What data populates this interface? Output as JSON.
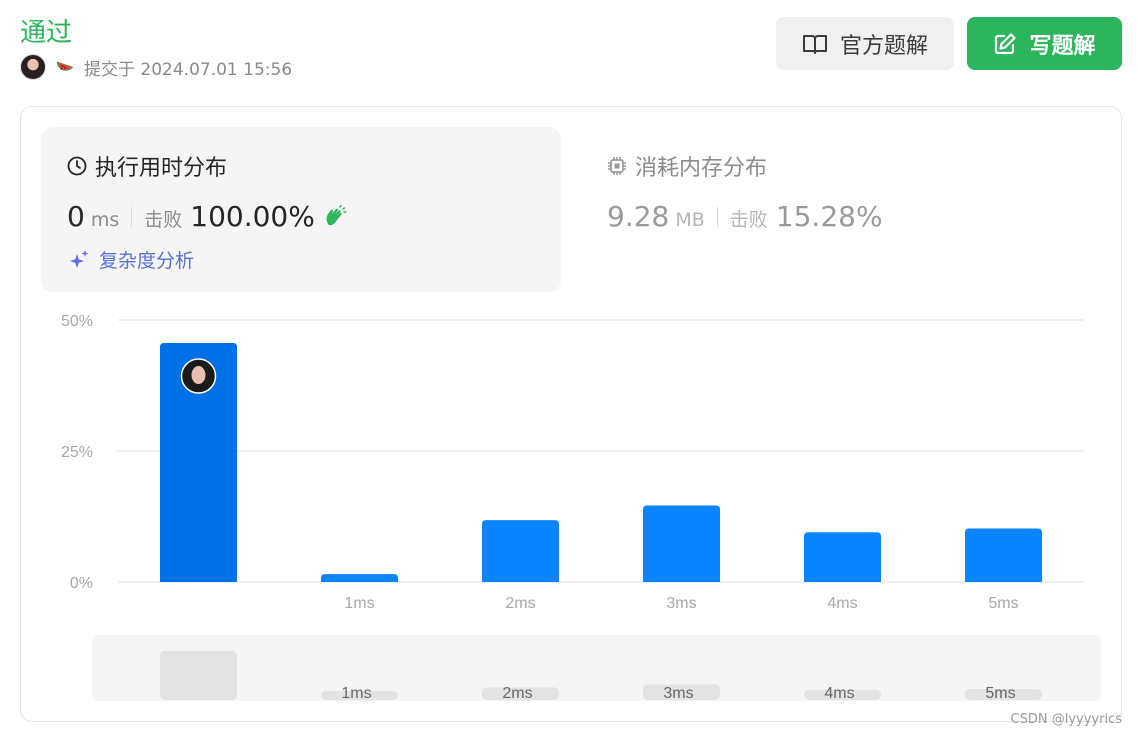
{
  "header": {
    "status": "通过",
    "submitted_label": "提交于 2024.07.01 15:56",
    "official_solution_label": "官方题解",
    "write_solution_label": "写题解"
  },
  "runtime": {
    "title": "执行用时分布",
    "value": "0",
    "unit": "ms",
    "beats_label": "击败",
    "beats_value": "100.00%",
    "analysis_label": "复杂度分析"
  },
  "memory": {
    "title": "消耗内存分布",
    "value": "9.28",
    "unit": "MB",
    "beats_label": "击败",
    "beats_value": "15.28%"
  },
  "colors": {
    "accent_green": "#2db55d",
    "bar_blue": "#0a84ff",
    "bar_highlight": "#0070e6"
  },
  "chart_data": {
    "type": "bar",
    "categories": [
      "",
      "1ms",
      "2ms",
      "3ms",
      "4ms",
      "5ms"
    ],
    "values": [
      45.6,
      1.5,
      11.8,
      14.6,
      9.5,
      10.2
    ],
    "highlighted_index": 0,
    "ytick_labels": [
      "0%",
      "25%",
      "50%"
    ],
    "yticks": [
      0,
      25,
      50
    ],
    "ylim": [
      0,
      50
    ],
    "grid": true,
    "overview_labels": [
      "",
      "1ms",
      "2ms",
      "3ms",
      "4ms",
      "5ms"
    ]
  },
  "watermark": "CSDN @lyyyyrics"
}
